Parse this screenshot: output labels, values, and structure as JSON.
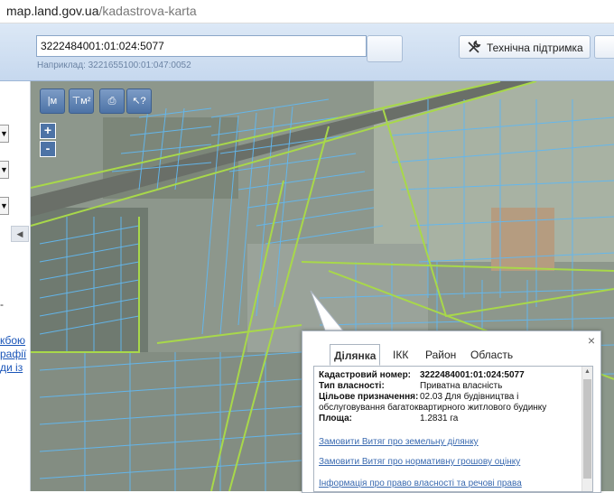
{
  "browser": {
    "url_domain": "map.land.gov.ua",
    "url_path": "/kadastrova-karta"
  },
  "header": {
    "search_value": "3222484001:01:024:5077",
    "example_text": "Наприклад: 3221655100:01:047:0052",
    "support_label": "Технічна підтримка"
  },
  "left_panel": {
    "dash": "-",
    "links": [
      "кбою",
      "рафії",
      "ди  із"
    ]
  },
  "map_tools": {
    "ruler_label": "м",
    "area_label": "м²",
    "print_icon": "printer-icon",
    "identify_icon": "cursor-question-icon",
    "zoom_in": "+",
    "zoom_out": "-"
  },
  "popup": {
    "tabs": [
      "Ділянка",
      "ІКК",
      "Район",
      "Область"
    ],
    "active_tab": "Ділянка",
    "fields": [
      {
        "label": "Кадастровий номер:",
        "value": "3222484001:01:024:5077",
        "bold": true
      },
      {
        "label": "Тип власності:",
        "value": "Приватна власність"
      },
      {
        "label": "Цільове призначення:",
        "value": "02.03 Для будівництва і"
      },
      {
        "label": "",
        "value": "обслуговування багатоквартирного житлового будинку"
      },
      {
        "label": "Площа:",
        "value": "1.2831 га"
      }
    ],
    "links": [
      "Замовити Витяг про земельну ділянку",
      "Замовити Витяг про нормативну грошову оцінку",
      "Інформація про право власності та речові права"
    ],
    "close": "×"
  },
  "colors": {
    "parcel_outline": "#62b8f0",
    "boundary_line": "#a8d84a",
    "header_bg": "#c6d8ee",
    "link": "#1a55b8"
  }
}
